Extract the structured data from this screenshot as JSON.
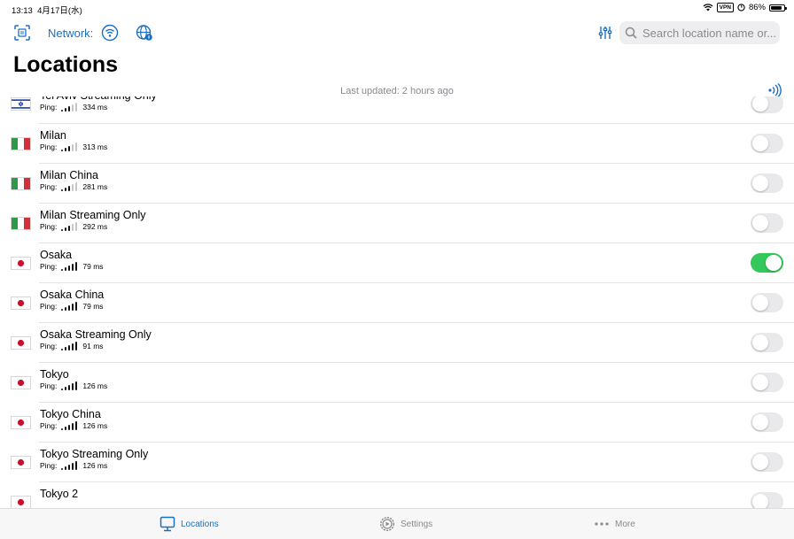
{
  "status_bar": {
    "time": "13:13",
    "date": "4月17日(水)",
    "vpn": "VPN",
    "battery": "86%",
    "battery_level": 0.86
  },
  "toolbar": {
    "network_label": "Network:",
    "search_placeholder": "Search location name or..."
  },
  "header": {
    "title": "Locations",
    "last_updated": "Last updated: 2 hours ago"
  },
  "ping_label": "Ping:",
  "rows": [
    {
      "name": "Tel Aviv Streaming Only",
      "flag": "israel",
      "ping": "334 ms",
      "signal": 3,
      "enabled": false
    },
    {
      "name": "Milan",
      "flag": "italy",
      "ping": "313 ms",
      "signal": 3,
      "enabled": false
    },
    {
      "name": "Milan China",
      "flag": "italy",
      "ping": "281 ms",
      "signal": 3,
      "enabled": false
    },
    {
      "name": "Milan Streaming Only",
      "flag": "italy",
      "ping": "292 ms",
      "signal": 3,
      "enabled": false
    },
    {
      "name": "Osaka",
      "flag": "japan",
      "ping": "79 ms",
      "signal": 5,
      "enabled": true
    },
    {
      "name": "Osaka China",
      "flag": "japan",
      "ping": "79 ms",
      "signal": 5,
      "enabled": false
    },
    {
      "name": "Osaka Streaming Only",
      "flag": "japan",
      "ping": "91 ms",
      "signal": 5,
      "enabled": false
    },
    {
      "name": "Tokyo",
      "flag": "japan",
      "ping": "126 ms",
      "signal": 5,
      "enabled": false
    },
    {
      "name": "Tokyo China",
      "flag": "japan",
      "ping": "126 ms",
      "signal": 5,
      "enabled": false
    },
    {
      "name": "Tokyo Streaming Only",
      "flag": "japan",
      "ping": "126 ms",
      "signal": 5,
      "enabled": false
    },
    {
      "name": "Tokyo 2",
      "flag": "japan",
      "ping": "",
      "signal": 0,
      "enabled": false
    }
  ],
  "tabs": [
    {
      "label": "Locations",
      "icon": "monitor-icon",
      "active": true
    },
    {
      "label": "Settings",
      "icon": "gear-icon",
      "active": false
    },
    {
      "label": "More",
      "icon": "ellipsis-icon",
      "active": false
    }
  ],
  "colors": {
    "accent": "#1b6fc2",
    "toggle_on": "#34c759",
    "toggle_off": "#e9e9eb"
  }
}
